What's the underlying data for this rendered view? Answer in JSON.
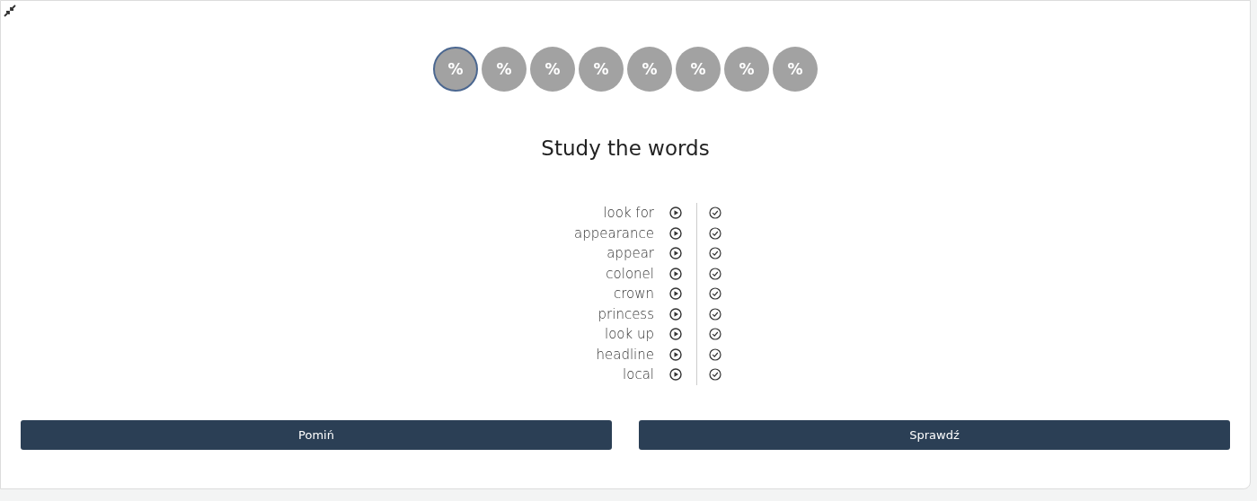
{
  "progress": [
    {
      "label": "%",
      "selected": true
    },
    {
      "label": "%",
      "selected": false
    },
    {
      "label": "%",
      "selected": false
    },
    {
      "label": "%",
      "selected": false
    },
    {
      "label": "%",
      "selected": false
    },
    {
      "label": "%",
      "selected": false
    },
    {
      "label": "%",
      "selected": false
    },
    {
      "label": "%",
      "selected": false
    }
  ],
  "title": "Study the words",
  "words": [
    {
      "text": "look for",
      "checked": true
    },
    {
      "text": "appearance",
      "checked": true
    },
    {
      "text": "appear",
      "checked": true
    },
    {
      "text": "colonel",
      "checked": true
    },
    {
      "text": "crown",
      "checked": true
    },
    {
      "text": "princess",
      "checked": true
    },
    {
      "text": "look up",
      "checked": true
    },
    {
      "text": "headline",
      "checked": true
    },
    {
      "text": "local",
      "checked": true
    }
  ],
  "buttons": [
    "Pomiń",
    "Sprawdź"
  ]
}
